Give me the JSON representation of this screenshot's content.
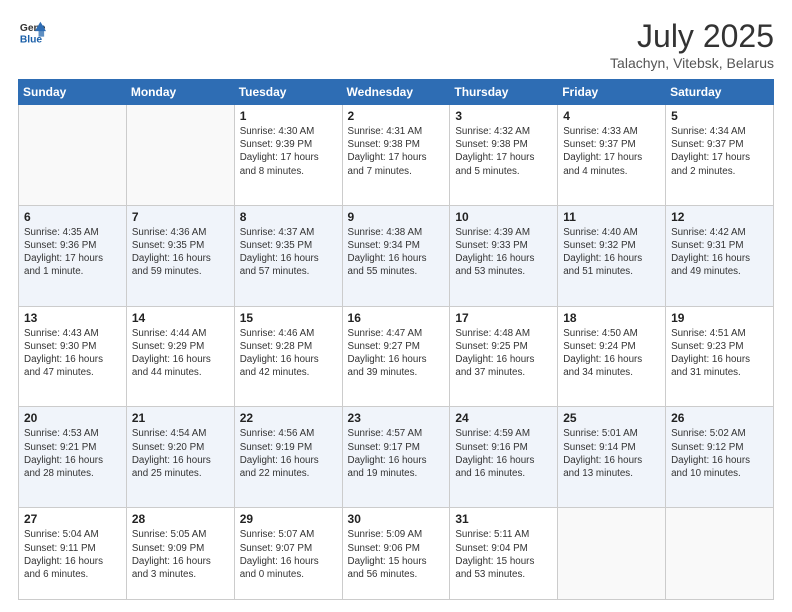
{
  "header": {
    "logo_general": "General",
    "logo_blue": "Blue",
    "title": "July 2025",
    "location": "Talachyn, Vitebsk, Belarus"
  },
  "days_of_week": [
    "Sunday",
    "Monday",
    "Tuesday",
    "Wednesday",
    "Thursday",
    "Friday",
    "Saturday"
  ],
  "weeks": [
    [
      {
        "day": "",
        "info": ""
      },
      {
        "day": "",
        "info": ""
      },
      {
        "day": "1",
        "info": "Sunrise: 4:30 AM\nSunset: 9:39 PM\nDaylight: 17 hours\nand 8 minutes."
      },
      {
        "day": "2",
        "info": "Sunrise: 4:31 AM\nSunset: 9:38 PM\nDaylight: 17 hours\nand 7 minutes."
      },
      {
        "day": "3",
        "info": "Sunrise: 4:32 AM\nSunset: 9:38 PM\nDaylight: 17 hours\nand 5 minutes."
      },
      {
        "day": "4",
        "info": "Sunrise: 4:33 AM\nSunset: 9:37 PM\nDaylight: 17 hours\nand 4 minutes."
      },
      {
        "day": "5",
        "info": "Sunrise: 4:34 AM\nSunset: 9:37 PM\nDaylight: 17 hours\nand 2 minutes."
      }
    ],
    [
      {
        "day": "6",
        "info": "Sunrise: 4:35 AM\nSunset: 9:36 PM\nDaylight: 17 hours\nand 1 minute."
      },
      {
        "day": "7",
        "info": "Sunrise: 4:36 AM\nSunset: 9:35 PM\nDaylight: 16 hours\nand 59 minutes."
      },
      {
        "day": "8",
        "info": "Sunrise: 4:37 AM\nSunset: 9:35 PM\nDaylight: 16 hours\nand 57 minutes."
      },
      {
        "day": "9",
        "info": "Sunrise: 4:38 AM\nSunset: 9:34 PM\nDaylight: 16 hours\nand 55 minutes."
      },
      {
        "day": "10",
        "info": "Sunrise: 4:39 AM\nSunset: 9:33 PM\nDaylight: 16 hours\nand 53 minutes."
      },
      {
        "day": "11",
        "info": "Sunrise: 4:40 AM\nSunset: 9:32 PM\nDaylight: 16 hours\nand 51 minutes."
      },
      {
        "day": "12",
        "info": "Sunrise: 4:42 AM\nSunset: 9:31 PM\nDaylight: 16 hours\nand 49 minutes."
      }
    ],
    [
      {
        "day": "13",
        "info": "Sunrise: 4:43 AM\nSunset: 9:30 PM\nDaylight: 16 hours\nand 47 minutes."
      },
      {
        "day": "14",
        "info": "Sunrise: 4:44 AM\nSunset: 9:29 PM\nDaylight: 16 hours\nand 44 minutes."
      },
      {
        "day": "15",
        "info": "Sunrise: 4:46 AM\nSunset: 9:28 PM\nDaylight: 16 hours\nand 42 minutes."
      },
      {
        "day": "16",
        "info": "Sunrise: 4:47 AM\nSunset: 9:27 PM\nDaylight: 16 hours\nand 39 minutes."
      },
      {
        "day": "17",
        "info": "Sunrise: 4:48 AM\nSunset: 9:25 PM\nDaylight: 16 hours\nand 37 minutes."
      },
      {
        "day": "18",
        "info": "Sunrise: 4:50 AM\nSunset: 9:24 PM\nDaylight: 16 hours\nand 34 minutes."
      },
      {
        "day": "19",
        "info": "Sunrise: 4:51 AM\nSunset: 9:23 PM\nDaylight: 16 hours\nand 31 minutes."
      }
    ],
    [
      {
        "day": "20",
        "info": "Sunrise: 4:53 AM\nSunset: 9:21 PM\nDaylight: 16 hours\nand 28 minutes."
      },
      {
        "day": "21",
        "info": "Sunrise: 4:54 AM\nSunset: 9:20 PM\nDaylight: 16 hours\nand 25 minutes."
      },
      {
        "day": "22",
        "info": "Sunrise: 4:56 AM\nSunset: 9:19 PM\nDaylight: 16 hours\nand 22 minutes."
      },
      {
        "day": "23",
        "info": "Sunrise: 4:57 AM\nSunset: 9:17 PM\nDaylight: 16 hours\nand 19 minutes."
      },
      {
        "day": "24",
        "info": "Sunrise: 4:59 AM\nSunset: 9:16 PM\nDaylight: 16 hours\nand 16 minutes."
      },
      {
        "day": "25",
        "info": "Sunrise: 5:01 AM\nSunset: 9:14 PM\nDaylight: 16 hours\nand 13 minutes."
      },
      {
        "day": "26",
        "info": "Sunrise: 5:02 AM\nSunset: 9:12 PM\nDaylight: 16 hours\nand 10 minutes."
      }
    ],
    [
      {
        "day": "27",
        "info": "Sunrise: 5:04 AM\nSunset: 9:11 PM\nDaylight: 16 hours\nand 6 minutes."
      },
      {
        "day": "28",
        "info": "Sunrise: 5:05 AM\nSunset: 9:09 PM\nDaylight: 16 hours\nand 3 minutes."
      },
      {
        "day": "29",
        "info": "Sunrise: 5:07 AM\nSunset: 9:07 PM\nDaylight: 16 hours\nand 0 minutes."
      },
      {
        "day": "30",
        "info": "Sunrise: 5:09 AM\nSunset: 9:06 PM\nDaylight: 15 hours\nand 56 minutes."
      },
      {
        "day": "31",
        "info": "Sunrise: 5:11 AM\nSunset: 9:04 PM\nDaylight: 15 hours\nand 53 minutes."
      },
      {
        "day": "",
        "info": ""
      },
      {
        "day": "",
        "info": ""
      }
    ]
  ]
}
